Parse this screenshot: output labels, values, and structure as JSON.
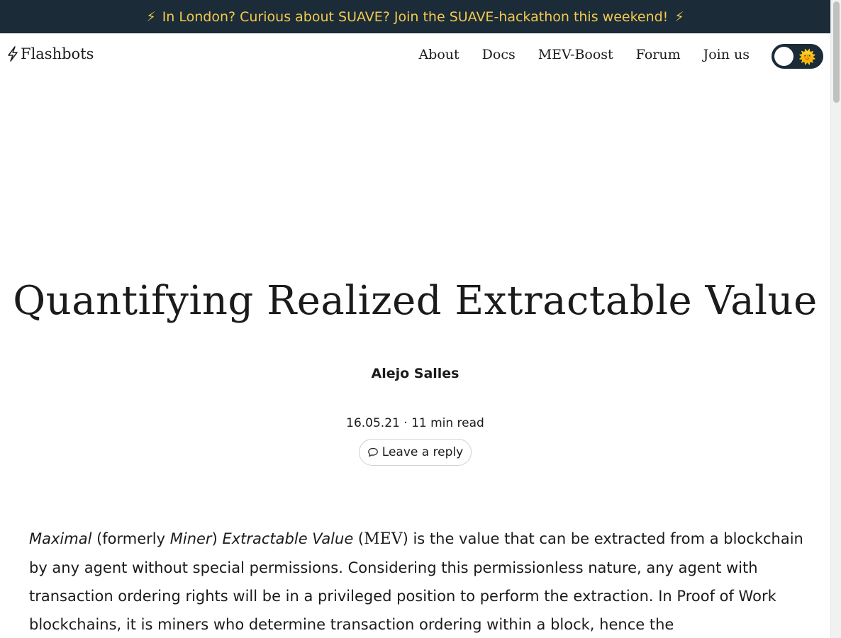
{
  "banner": {
    "bolt_left": "⚡",
    "text": "In London? Curious about SUAVE? Join the SUAVE-hackathon this weekend!",
    "bolt_right": "⚡"
  },
  "nav": {
    "brand": "Flashbots",
    "links": [
      "About",
      "Docs",
      "MEV-Boost",
      "Forum",
      "Join us"
    ],
    "theme_toggle_icon": "🌞"
  },
  "article": {
    "title": "Quantifying Realized Extractable Value",
    "author": "Alejo Salles",
    "date": "16.05.21",
    "separator": " · ",
    "read_time": "11 min read",
    "reply_label": "Leave a reply",
    "paragraph": {
      "p1": "Maximal",
      "p2": " (formerly ",
      "p3": "Miner",
      "p4": ") ",
      "p5": "Extractable Value",
      "p6": " (",
      "p7": "MEV",
      "p8": ") is the value that can be extracted from a blockchain by any agent without special permissions. Considering this permissionless nature, any agent with transaction ordering rights will be in a privileged position to perform the extraction. In Proof of Work blockchains, it is miners who determine transaction ordering within a block, hence the"
    }
  },
  "colors": {
    "banner_bg": "#1b2b38",
    "banner_text": "#f2c94c",
    "text": "#1b1b1d"
  }
}
